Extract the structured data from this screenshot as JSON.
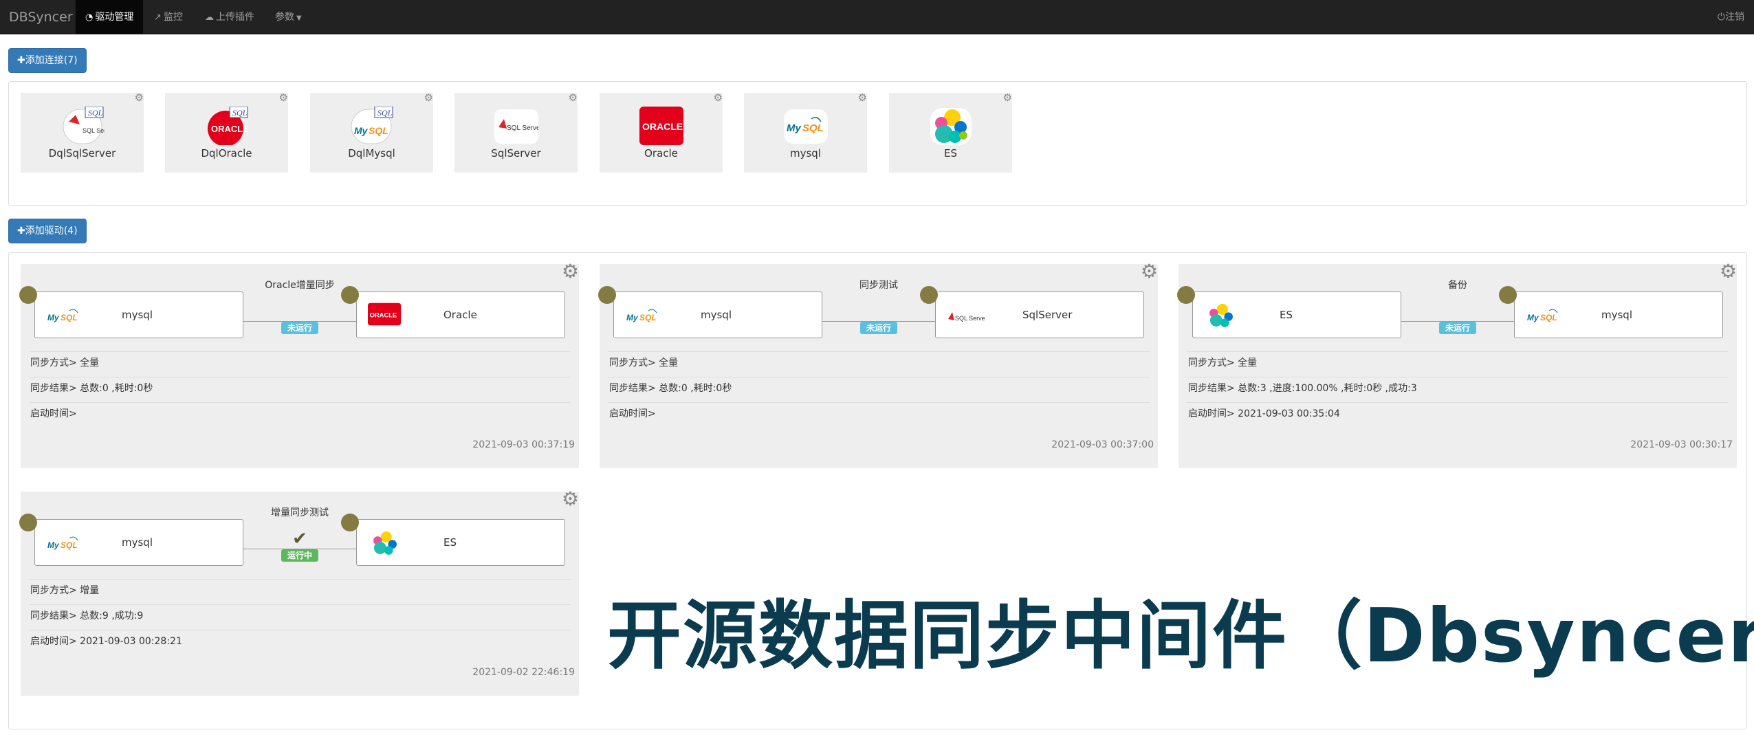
{
  "navbar": {
    "brand": "DBSyncer",
    "items": [
      {
        "label": "驱动管理",
        "icon": "dashboard-icon"
      },
      {
        "label": "监控",
        "icon": "line-chart-icon"
      },
      {
        "label": "上传插件",
        "icon": "cloud-upload-icon"
      },
      {
        "label": "参数",
        "icon": "caret-down-icon"
      }
    ],
    "logout": "注销"
  },
  "add_connection_label": "添加连接(7)",
  "add_driver_label": "添加驱动(4)",
  "connections": [
    {
      "name": "DqlSqlServer",
      "logo": "sqlserver-dql-logo"
    },
    {
      "name": "DqlOracle",
      "logo": "oracle-dql-logo"
    },
    {
      "name": "DqlMysql",
      "logo": "mysql-dql-logo"
    },
    {
      "name": "SqlServer",
      "logo": "sqlserver-logo"
    },
    {
      "name": "Oracle",
      "logo": "oracle-logo"
    },
    {
      "name": "mysql",
      "logo": "mysql-logo"
    },
    {
      "name": "ES",
      "logo": "elasticsearch-logo"
    }
  ],
  "drivers": [
    {
      "title": "Oracle增量同步",
      "source": "mysql",
      "target": "Oracle",
      "status": "未运行",
      "mode": "同步方式> 全量",
      "result": "同步结果> 总数:0 ,耗时:0秒",
      "start": "启动时间>",
      "time": "2021-09-03 00:37:19"
    },
    {
      "title": "同步测试",
      "source": "mysql",
      "target": "SqlServer",
      "status": "未运行",
      "mode": "同步方式> 全量",
      "result": "同步结果> 总数:0 ,耗时:0秒",
      "start": "启动时间>",
      "time": "2021-09-03 00:37:00"
    },
    {
      "title": "备份",
      "source": "ES",
      "target": "mysql",
      "status": "未运行",
      "mode": "同步方式> 全量",
      "result": "同步结果> 总数:3 ,进度:100.00% ,耗时:0秒 ,成功:3",
      "start": "启动时间> 2021-09-03 00:35:04",
      "time": "2021-09-03 00:30:17"
    },
    {
      "title": "增量同步测试",
      "source": "mysql",
      "target": "ES",
      "status": "运行中",
      "mode": "同步方式> 增量",
      "result": "同步结果> 总数:9 ,成功:9",
      "start": "启动时间> 2021-09-03 00:28:21",
      "time": "2021-09-02 22:46:19"
    }
  ],
  "overlay_title": "开源数据同步中间件（Dbsyncer）"
}
